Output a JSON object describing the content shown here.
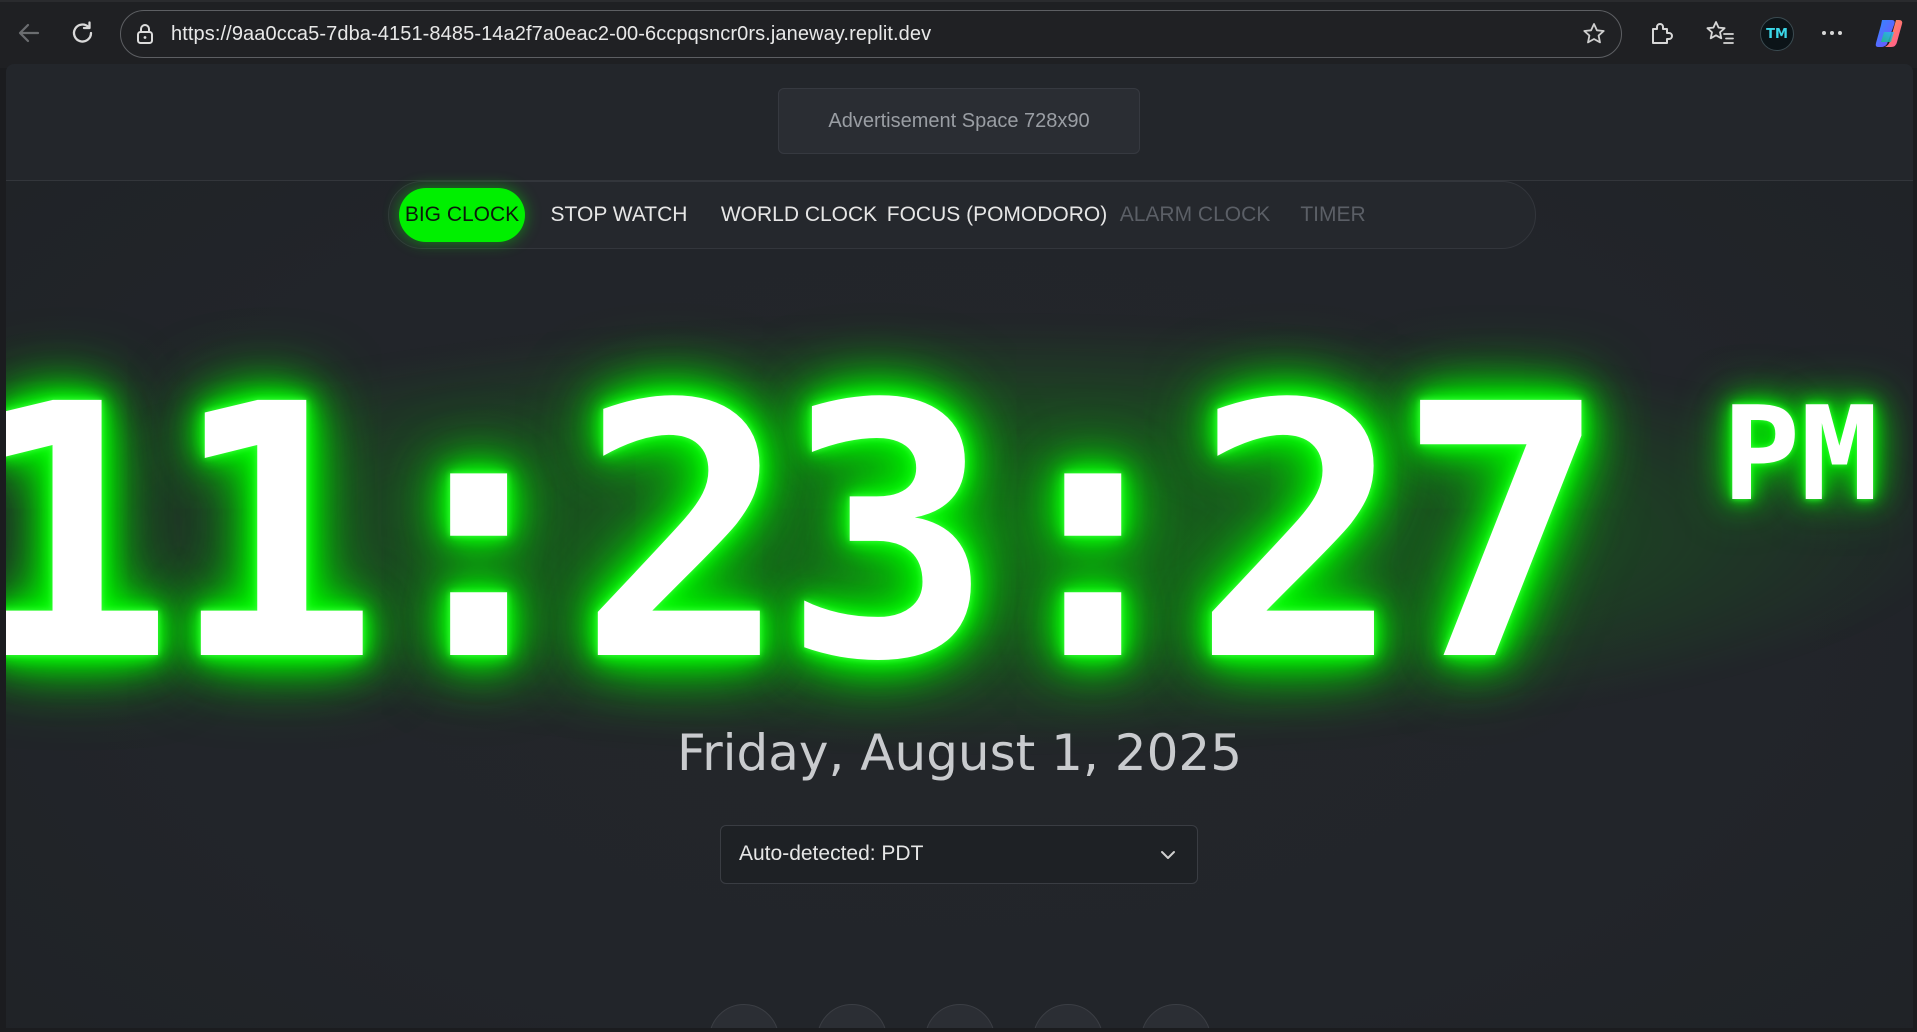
{
  "browser": {
    "url": "https://9aa0cca5-7dba-4151-8485-14a2f7a0eac2-00-6ccpqsncr0rs.janeway.replit.dev",
    "avatar_initials": "TM",
    "icons": {
      "back": "back-arrow-icon",
      "reload": "reload-icon",
      "lock": "site-info-icon",
      "favorite": "star-icon",
      "extensions": "puzzle-icon",
      "favorites": "favorites-icon",
      "more": "more-icon",
      "copilot": "copilot-icon"
    }
  },
  "ad": {
    "label": "Advertisement Space 728x90"
  },
  "tabs": [
    {
      "label": "BIG CLOCK",
      "state": "active"
    },
    {
      "label": "STOP WATCH",
      "state": "normal"
    },
    {
      "label": "WORLD CLOCK",
      "state": "normal"
    },
    {
      "label": "FOCUS (POMODORO)",
      "state": "normal"
    },
    {
      "label": "ALARM CLOCK",
      "state": "disabled"
    },
    {
      "label": "TIMER",
      "state": "disabled"
    }
  ],
  "clock": {
    "time": "11:23:27",
    "ampm": "PM"
  },
  "date": "Friday, August 1, 2025",
  "timezone": {
    "selected": "Auto-detected: PDT"
  },
  "colors": {
    "accent": "#00f000",
    "glow": "#00ff00",
    "background": "#22252a"
  }
}
